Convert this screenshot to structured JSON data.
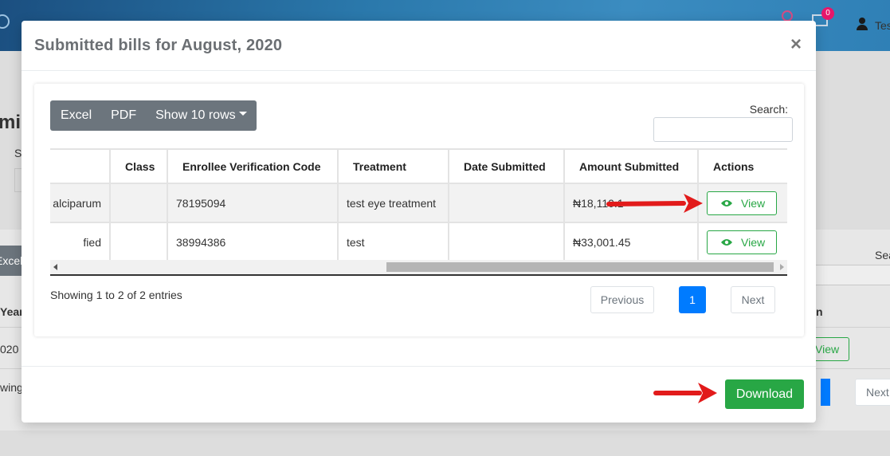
{
  "background": {
    "notification_badge": "0",
    "user_name_partial": "Tes",
    "heading_partial": "mi",
    "label_partial": "S",
    "excel_partial": "Excel",
    "search_partial": "Sea",
    "year_header_partial": "Year",
    "year_value_partial": "020",
    "showing_partial": "wing",
    "n_partial": "n",
    "view_partial": "View",
    "next_partial": "Next"
  },
  "modal": {
    "title": "Submitted bills for August, 2020",
    "close": "×",
    "toolbar": {
      "excel": "Excel",
      "pdf": "PDF",
      "show_rows": "Show 10 rows"
    },
    "search_label": "Search:",
    "search_value": "",
    "table": {
      "columns": [
        "",
        "Class",
        "Enrollee Verification Code",
        "Treatment",
        "Date Submitted",
        "Amount Submitted",
        "Actions"
      ],
      "rows": [
        {
          "diagnosis": "alciparum",
          "class": "",
          "code": "78195094",
          "treatment": "test eye treatment",
          "date": "",
          "amount": "₦18,110.1",
          "action": "View"
        },
        {
          "diagnosis": "fied",
          "class": "",
          "code": "38994386",
          "treatment": "test",
          "date": "",
          "amount": "₦33,001.45",
          "action": "View"
        }
      ]
    },
    "info": "Showing 1 to 2 of 2 entries",
    "pagination": {
      "previous": "Previous",
      "current": "1",
      "next": "Next"
    },
    "download": "Download"
  },
  "colors": {
    "accent_green": "#28a745",
    "accent_blue": "#007bff",
    "annotation_red": "#e21b1b"
  }
}
